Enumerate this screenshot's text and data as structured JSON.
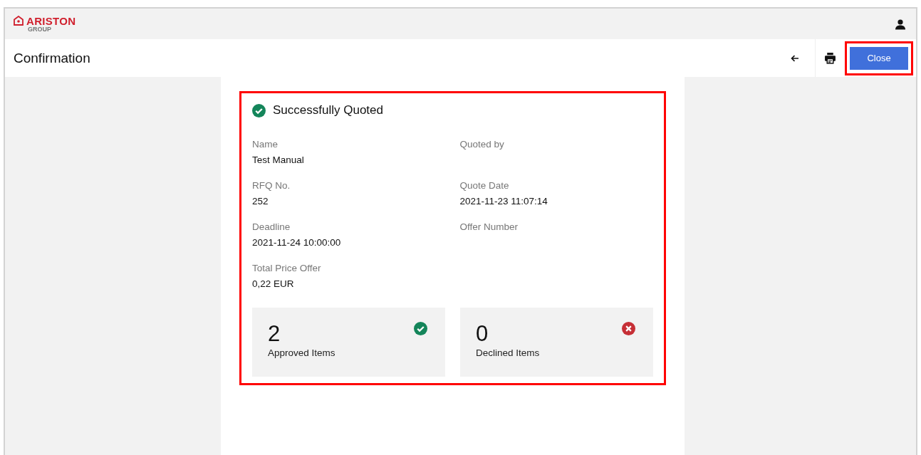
{
  "header": {
    "logo": {
      "name": "ARISTON",
      "sub": "GROUP"
    }
  },
  "toolbar": {
    "title": "Confirmation",
    "close_button": {
      "label": "Close",
      "highlighted": true
    }
  },
  "card": {
    "highlighted": true,
    "status": "Successfully Quoted",
    "fields": [
      {
        "label": "Name",
        "value": "Test Manual"
      },
      {
        "label": "Quoted by"
      },
      {
        "label": "RFQ No.",
        "value": "252"
      },
      {
        "label": "Quote Date",
        "value": "2021-11-23 11:07:14"
      },
      {
        "label": "Deadline",
        "value": "2021-11-24 10:00:00"
      },
      {
        "label": "Offer Number"
      },
      {
        "label": "Total Price Offer",
        "value": "0,22 EUR"
      }
    ],
    "tiles": [
      {
        "kind": "approved",
        "count": "2",
        "label": "Approved Items"
      },
      {
        "kind": "declined",
        "count": "0",
        "label": "Declined Items"
      }
    ]
  }
}
